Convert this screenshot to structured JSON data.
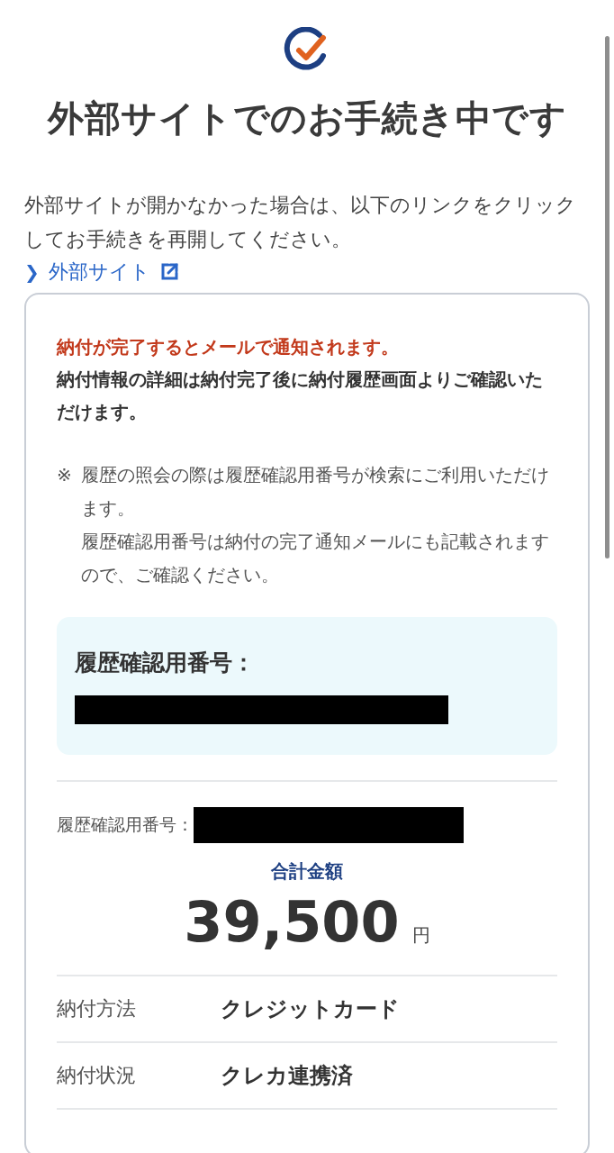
{
  "title": "外部サイトでのお手続き中です",
  "intro": "外部サイトが開かなかった場合は、以下のリンクをクリックしてお手続きを再開してください。",
  "external_link": {
    "chevron": "❯",
    "label": "外部サイト"
  },
  "notice": {
    "alert": "納付が完了するとメールで通知されます。",
    "detail": "納付情報の詳細は納付完了後に納付履歴画面よりご確認いただけます。"
  },
  "note": {
    "mark": "※",
    "lines": [
      "履歴の照会の際は履歴確認用番号が検索にご利用いただけます。",
      "履歴確認用番号は納付の完了通知メールにも記載されますので、ご確認ください。"
    ]
  },
  "reference_box": {
    "label": "履歴確認用番号："
  },
  "reference_row": {
    "label": "履歴確認用番号："
  },
  "total": {
    "label": "合計金額",
    "amount": "39,500",
    "unit": "円"
  },
  "details": [
    {
      "label": "納付方法",
      "value": "クレジットカード"
    },
    {
      "label": "納付状況",
      "value": "クレカ連携済"
    }
  ]
}
